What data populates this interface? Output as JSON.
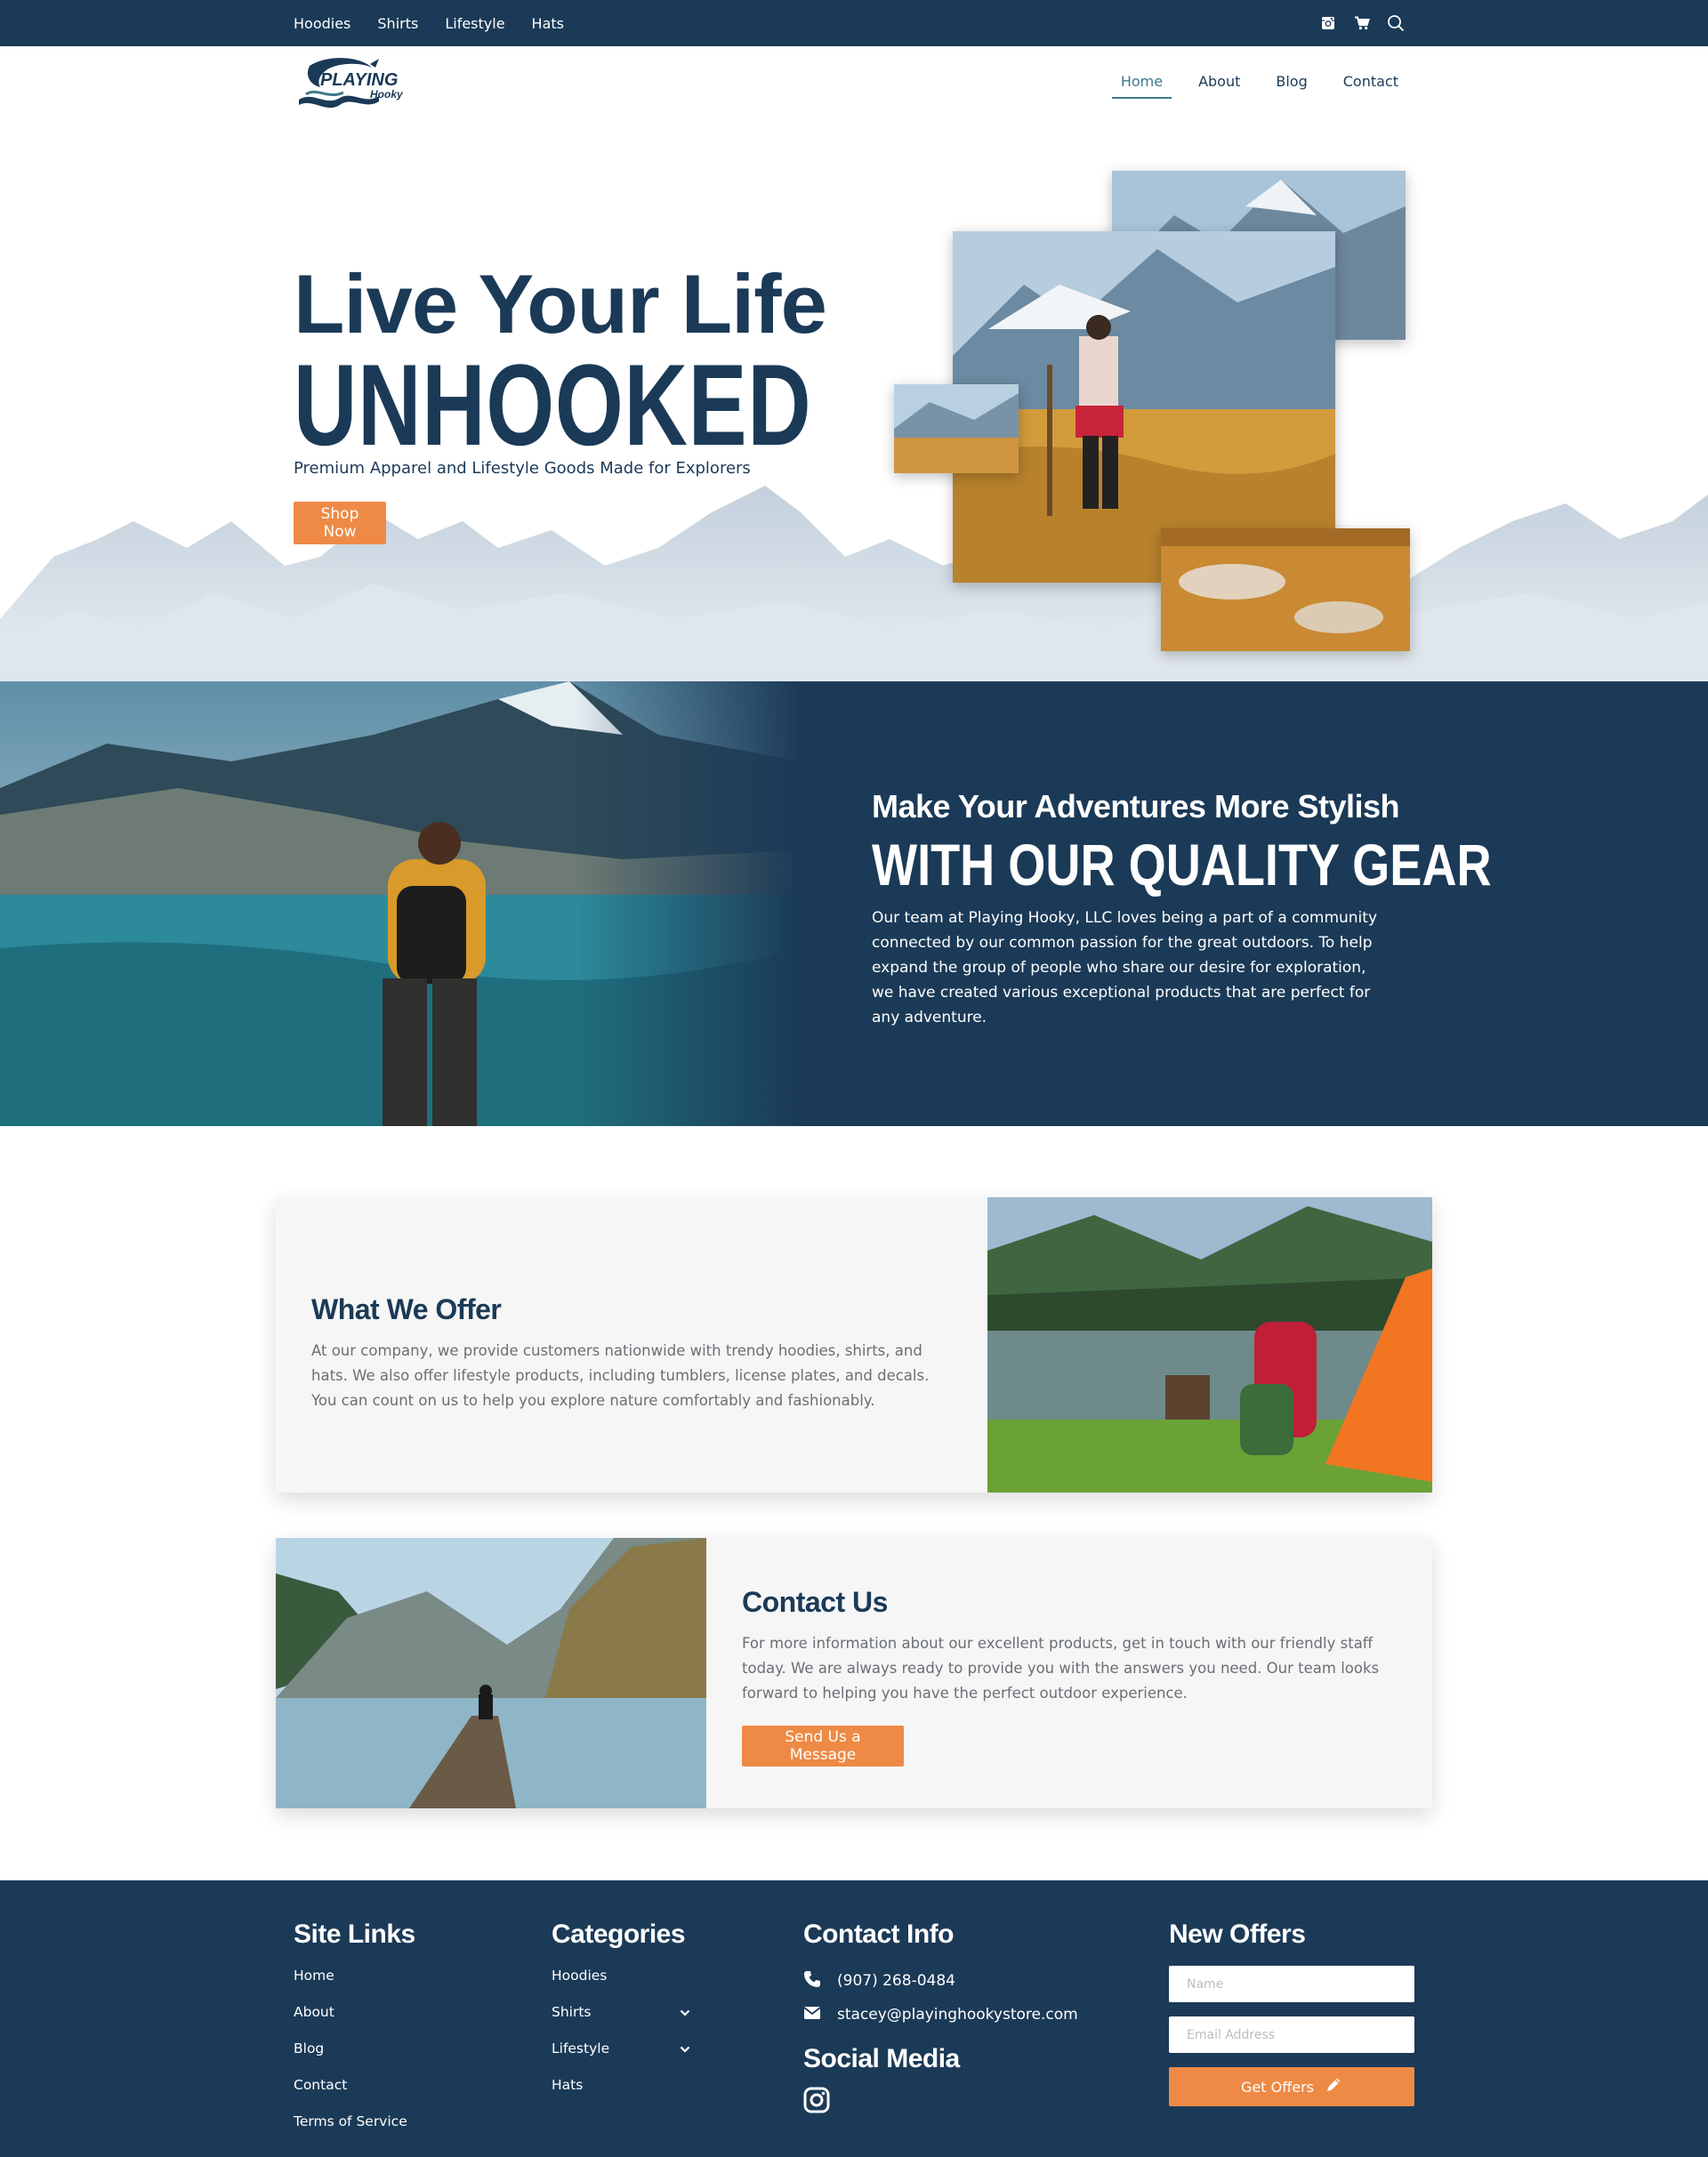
{
  "topbar": {
    "categories": [
      "Hoodies",
      "Shirts",
      "Lifestyle",
      "Hats"
    ],
    "icons": [
      "instagram-icon",
      "cart-icon",
      "search-icon"
    ]
  },
  "header": {
    "logo_line1": "PLAYING",
    "logo_line2": "Hooky",
    "nav": [
      "Home",
      "About",
      "Blog",
      "Contact"
    ],
    "active_nav": "Home"
  },
  "hero": {
    "title_line1": "Live Your Life",
    "title_line2": "UNHOOKED",
    "subtitle": "Premium Apparel and Lifestyle Goods Made for Explorers",
    "cta": "Shop Now"
  },
  "band": {
    "heading": "Make Your Adventures More Stylish",
    "heading_big": "WITH OUR QUALITY GEAR",
    "body": "Our team at Playing Hooky, LLC loves being a part of a community connected by our common passion for the great outdoors. To help expand the group of people who share our desire for exploration, we have created various exceptional products that are perfect for any adventure."
  },
  "offer_card": {
    "title": "What We Offer",
    "body": "At our company, we provide customers nationwide with trendy hoodies, shirts, and hats. We also offer lifestyle products, including tumblers, license plates, and decals. You can count on us to help you explore nature comfortably and fashionably."
  },
  "contact_card": {
    "title": "Contact Us",
    "body": "For more information about our excellent products, get in touch with our friendly staff today. We are always ready to provide you with the answers you need. Our team looks forward to helping you have the perfect outdoor experience.",
    "cta": "Send Us a Message"
  },
  "footer": {
    "site_links": {
      "title": "Site Links",
      "items": [
        "Home",
        "About",
        "Blog",
        "Contact",
        "Terms of Service"
      ]
    },
    "categories": {
      "title": "Categories",
      "items": [
        "Hoodies",
        "Shirts",
        "Lifestyle",
        "Hats"
      ]
    },
    "contact": {
      "title": "Contact Info",
      "phone": "(907) 268-0484",
      "email": "stacey@playinghookystore.com",
      "social_title": "Social Media"
    },
    "offers": {
      "title": "New Offers",
      "name_placeholder": "Name",
      "email_placeholder": "Email Address",
      "button": "Get Offers"
    }
  },
  "colors": {
    "navy": "#1b3a57",
    "accent_orange": "#ee8a46",
    "active_teal": "#3d7a8c",
    "card_bg": "#f6f6f6"
  }
}
